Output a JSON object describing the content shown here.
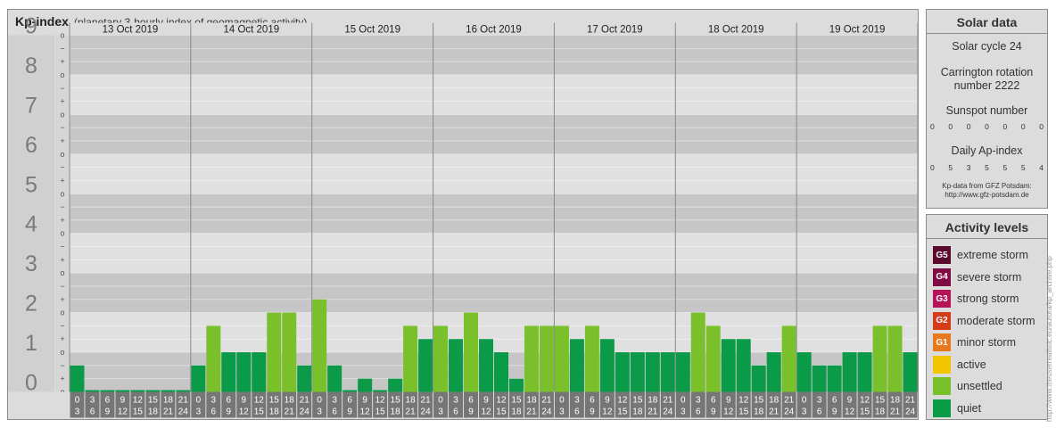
{
  "header": {
    "title": "Kp-index",
    "subtitle": "(planetary 3-hourly index of geomagnetic activity)"
  },
  "chart_data": {
    "type": "bar",
    "ylim": [
      0,
      9
    ],
    "y_ticks": [
      "0",
      "1",
      "2",
      "3",
      "4",
      "5",
      "6",
      "7",
      "8",
      "9"
    ],
    "y_sub_marks": [
      "o",
      "+",
      "−"
    ],
    "days": [
      "13 Oct 2019",
      "14 Oct 2019",
      "15 Oct 2019",
      "16 Oct 2019",
      "17 Oct 2019",
      "18 Oct 2019",
      "19 Oct 2019"
    ],
    "slots": [
      {
        "start": "0",
        "end": "3"
      },
      {
        "start": "3",
        "end": "6"
      },
      {
        "start": "6",
        "end": "9"
      },
      {
        "start": "9",
        "end": "12"
      },
      {
        "start": "12",
        "end": "15"
      },
      {
        "start": "15",
        "end": "18"
      },
      {
        "start": "18",
        "end": "21"
      },
      {
        "start": "21",
        "end": "24"
      }
    ],
    "values": [
      0.667,
      0,
      0,
      0,
      0,
      0,
      0,
      0,
      0.667,
      1.667,
      1,
      1,
      1,
      2,
      2,
      0.667,
      2.333,
      0.667,
      0,
      0.333,
      0,
      0.333,
      1.667,
      1.333,
      1.667,
      1.333,
      2,
      1.333,
      1,
      0.333,
      1.667,
      1.667,
      1.667,
      1.333,
      1.667,
      1.333,
      1,
      1,
      1,
      1,
      1,
      2,
      1.667,
      1.333,
      1.333,
      0.667,
      1,
      1.667,
      1,
      0.667,
      0.667,
      1,
      1,
      1.667,
      1.667,
      1
    ],
    "grid": true,
    "colors": {
      "quiet": "#0a9a48",
      "unsettled": "#7ac02a",
      "active": "#f3c400"
    }
  },
  "solar": {
    "title": "Solar data",
    "cycle": "Solar cycle 24",
    "carrington_line1": "Carrington rotation",
    "carrington_line2": "number 2222",
    "sunspot_label": "Sunspot number",
    "sunspot_values": [
      "0",
      "0",
      "0",
      "0",
      "0",
      "0",
      "0"
    ],
    "ap_label": "Daily Ap-index",
    "ap_values": [
      "0",
      "5",
      "3",
      "5",
      "5",
      "5",
      "4"
    ],
    "source_line1": "Kp-data from GFZ Potsdam:",
    "source_line2": "http://www.gfz-potsdam.de"
  },
  "activity": {
    "title": "Activity levels",
    "levels": [
      {
        "code": "G5",
        "label": "extreme storm",
        "color": "#5b0a2e"
      },
      {
        "code": "G4",
        "label": "severe storm",
        "color": "#800a44"
      },
      {
        "code": "G3",
        "label": "strong storm",
        "color": "#b4135a"
      },
      {
        "code": "G2",
        "label": "moderate storm",
        "color": "#d23c1a"
      },
      {
        "code": "G1",
        "label": "minor storm",
        "color": "#e8781e"
      },
      {
        "code": "",
        "label": "active",
        "color": "#f3c400"
      },
      {
        "code": "",
        "label": "unsettled",
        "color": "#7ac02a"
      },
      {
        "code": "",
        "label": "quiet",
        "color": "#0a9a48"
      }
    ]
  },
  "watermark": "http://www.theuserrealistic.eu/aurora/kp_archive.php"
}
